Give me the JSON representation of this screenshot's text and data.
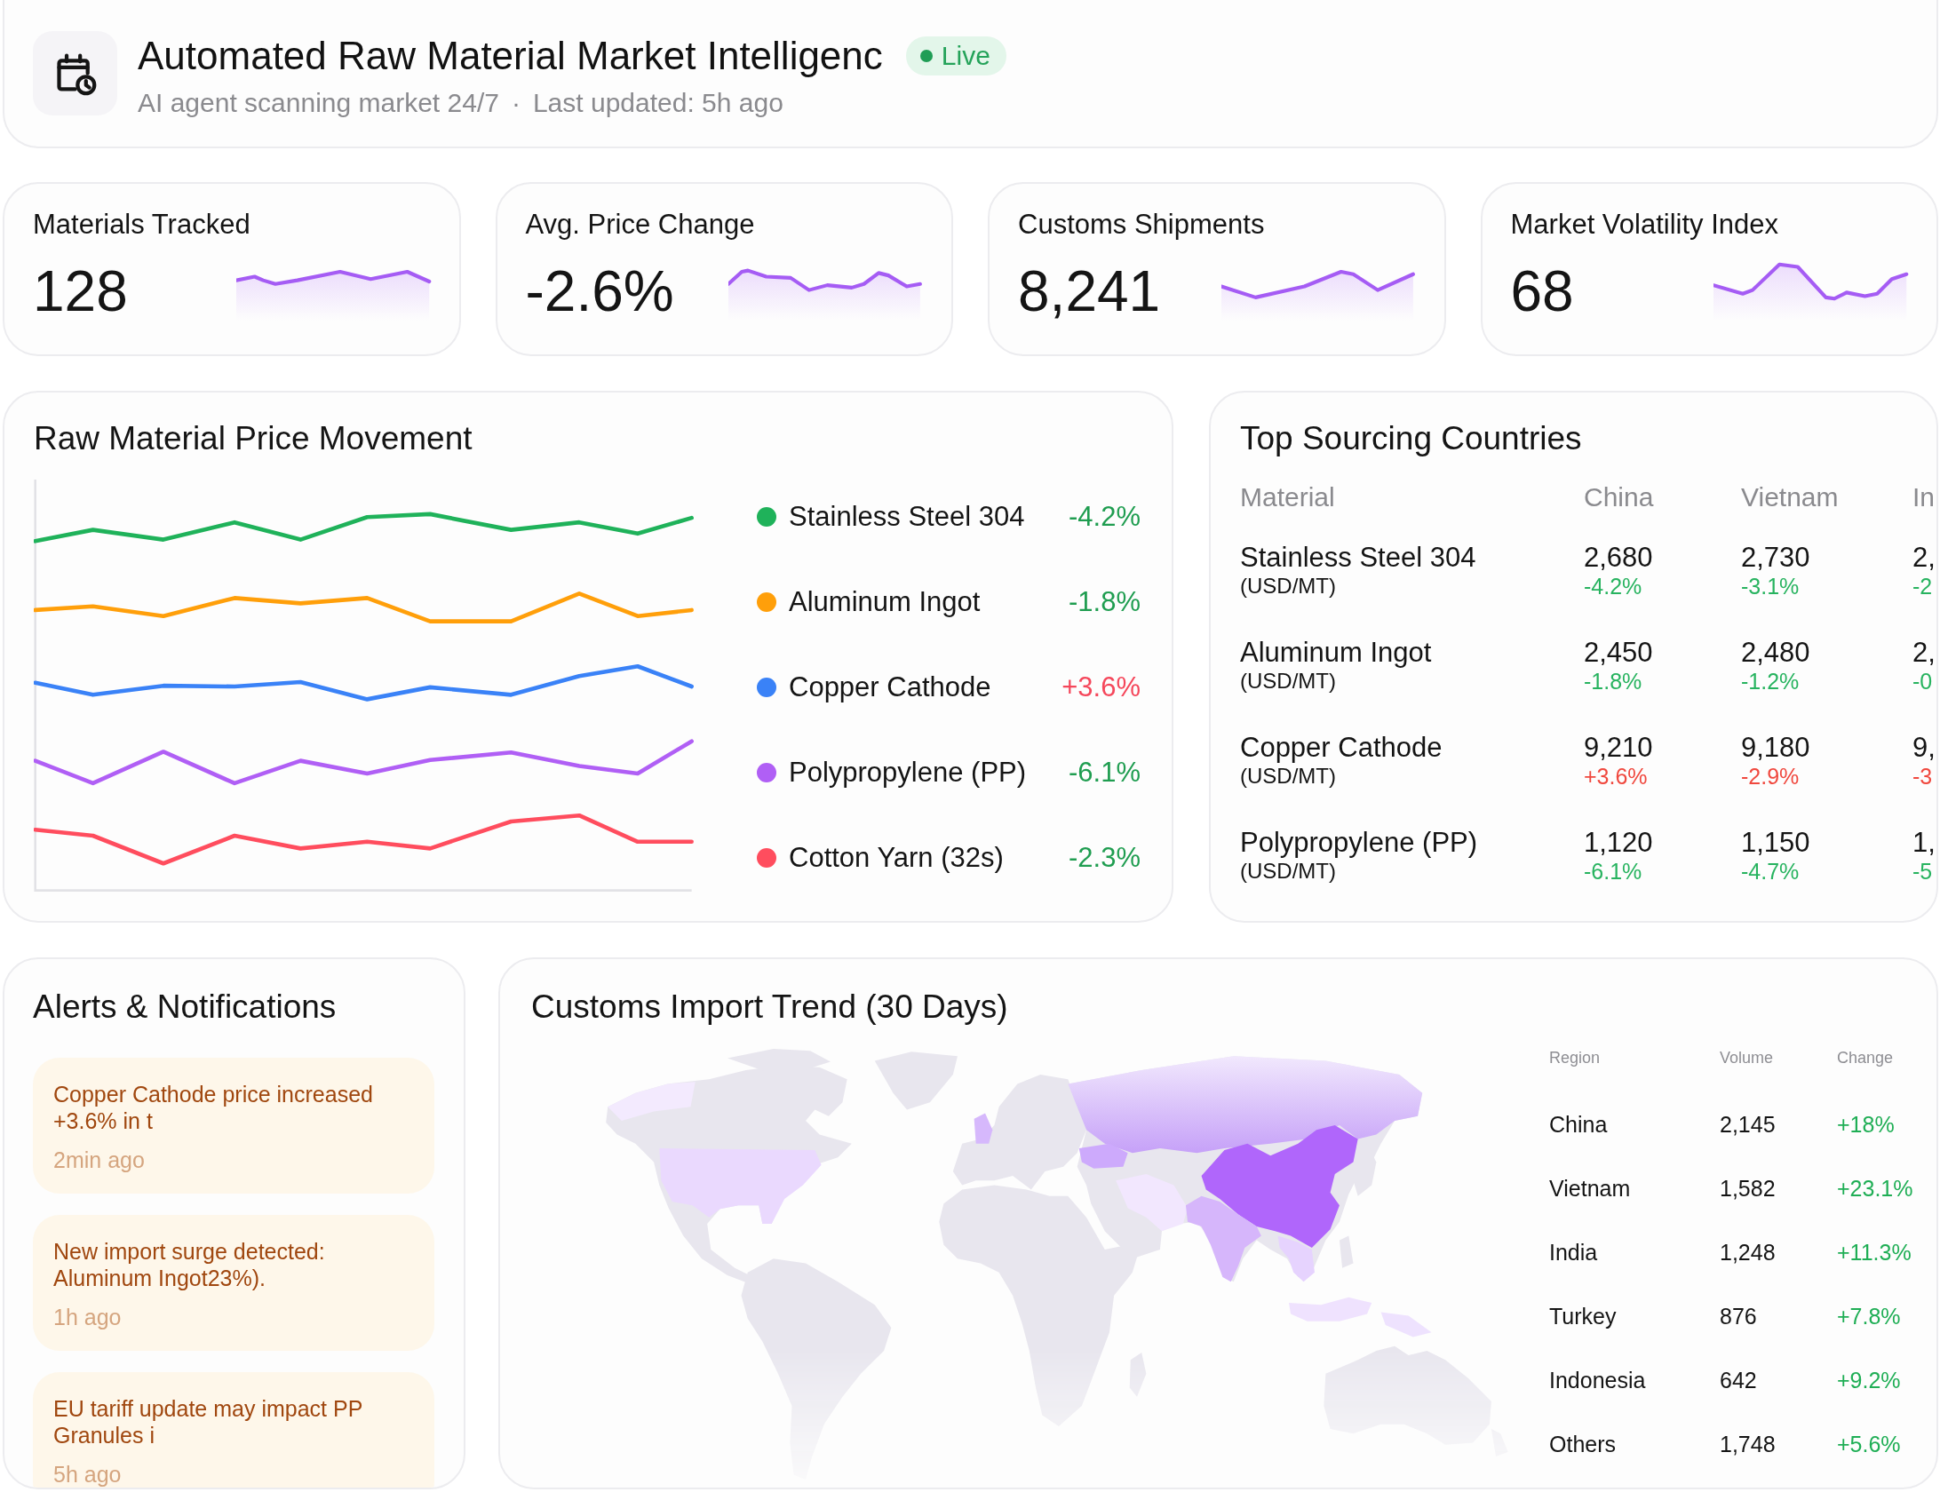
{
  "header": {
    "title": "Automated Raw Material Market Intelligenc",
    "status": "Live",
    "subtitle": "AI agent scanning market 24/7",
    "separator": "·",
    "updated": "Last updated: 5h ago"
  },
  "kpis": [
    {
      "label": "Materials Tracked",
      "value": "128"
    },
    {
      "label": "Avg. Price Change",
      "value": "-2.6%"
    },
    {
      "label": "Customs Shipments",
      "value": "8,241"
    },
    {
      "label": "Market Volatility Index",
      "value": "68"
    }
  ],
  "price_movement": {
    "title": "Raw Material Price Movement",
    "series": [
      {
        "name": "Stainless Steel 304",
        "color": "#1fb25a",
        "change": {
          "text": "-4.2%",
          "color": "#1f9d50"
        }
      },
      {
        "name": "Aluminum Ingot",
        "color": "#ff9f0a",
        "change": {
          "text": "-1.8%",
          "color": "#1f9d50"
        }
      },
      {
        "name": "Copper Cathode",
        "color": "#3a82f7",
        "change": {
          "text": "+3.6%",
          "color": "#f5475b"
        }
      },
      {
        "name": "Polypropylene (PP)",
        "color": "#b05ff5",
        "change": {
          "text": "-6.1%",
          "color": "#1f9d50"
        }
      },
      {
        "name": "Cotton Yarn (32s)",
        "color": "#ff4d5e",
        "change": {
          "text": "-2.3%",
          "color": "#1f9d50"
        }
      }
    ]
  },
  "sourcing": {
    "title": "Top Sourcing Countries",
    "columns": [
      "Material",
      "China",
      "Vietnam",
      "In"
    ],
    "rows": [
      {
        "material": "Stainless Steel 304",
        "unit": "(USD/MT)",
        "prices": [
          {
            "value": "2,680",
            "change": {
              "text": "-4.2%",
              "color": "#27b35f"
            }
          },
          {
            "value": "2,730",
            "change": {
              "text": "-3.1%",
              "color": "#27b35f"
            }
          },
          {
            "value": "2,",
            "change": {
              "text": "-2",
              "color": "#27b35f"
            }
          }
        ]
      },
      {
        "material": "Aluminum Ingot",
        "unit": "(USD/MT)",
        "prices": [
          {
            "value": "2,450",
            "change": {
              "text": "-1.8%",
              "color": "#27b35f"
            }
          },
          {
            "value": "2,480",
            "change": {
              "text": "-1.2%",
              "color": "#27b35f"
            }
          },
          {
            "value": "2,",
            "change": {
              "text": "-0",
              "color": "#27b35f"
            }
          }
        ]
      },
      {
        "material": "Copper Cathode",
        "unit": "(USD/MT)",
        "prices": [
          {
            "value": "9,210",
            "change": {
              "text": "+3.6%",
              "color": "#f0483e"
            }
          },
          {
            "value": "9,180",
            "change": {
              "text": "-2.9%",
              "color": "#f0483e"
            }
          },
          {
            "value": "9,",
            "change": {
              "text": "-3",
              "color": "#f0483e"
            }
          }
        ]
      },
      {
        "material": "Polypropylene (PP)",
        "unit": "(USD/MT)",
        "prices": [
          {
            "value": "1,120",
            "change": {
              "text": "-6.1%",
              "color": "#27b35f"
            }
          },
          {
            "value": "1,150",
            "change": {
              "text": "-4.7%",
              "color": "#27b35f"
            }
          },
          {
            "value": "1,",
            "change": {
              "text": "-5",
              "color": "#27b35f"
            }
          }
        ]
      }
    ]
  },
  "alerts": {
    "title": "Alerts & Notifications",
    "items": [
      {
        "message": "Copper Cathode price increased +3.6% in t",
        "time": "2min ago"
      },
      {
        "message": "New import surge detected: Aluminum Ingot23%).",
        "time": "1h ago"
      },
      {
        "message": "EU tariff update may impact PP Granules i",
        "time": "5h ago"
      }
    ]
  },
  "imports": {
    "title": "Customs Import Trend (30 Days)",
    "columns": [
      "Region",
      "Volume",
      "Change"
    ],
    "rows": [
      {
        "region": "China",
        "volume": "2,145",
        "change": "+18%"
      },
      {
        "region": "Vietnam",
        "volume": "1,582",
        "change": "+23.1%"
      },
      {
        "region": "India",
        "volume": "1,248",
        "change": "+11.3%"
      },
      {
        "region": "Turkey",
        "volume": "876",
        "change": "+7.8%"
      },
      {
        "region": "Indonesia",
        "volume": "642",
        "change": "+9.2%"
      },
      {
        "region": "Others",
        "volume": "1,748",
        "change": "+5.6%"
      }
    ]
  }
}
